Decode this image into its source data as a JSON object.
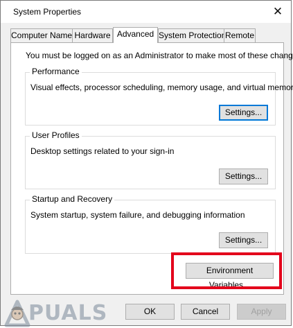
{
  "window": {
    "title": "System Properties",
    "close_glyph": "✕"
  },
  "tabs": [
    {
      "label": "Computer Name",
      "active": false
    },
    {
      "label": "Hardware",
      "active": false
    },
    {
      "label": "Advanced",
      "active": true
    },
    {
      "label": "System Protection",
      "active": false
    },
    {
      "label": "Remote",
      "active": false
    }
  ],
  "advanced": {
    "admin_message": "You must be logged on as an Administrator to make most of these changes.",
    "performance": {
      "title": "Performance",
      "description": "Visual effects, processor scheduling, memory usage, and virtual memory",
      "button": "Settings..."
    },
    "user_profiles": {
      "title": "User Profiles",
      "description": "Desktop settings related to your sign-in",
      "button": "Settings..."
    },
    "startup_recovery": {
      "title": "Startup and Recovery",
      "description": "System startup, system failure, and debugging information",
      "button": "Settings..."
    },
    "environment_button": "Environment Variables..."
  },
  "footer": {
    "ok": "OK",
    "cancel": "Cancel",
    "apply": "Apply"
  },
  "watermark": {
    "text": "PUALS"
  },
  "colors": {
    "highlight": "#e3001b",
    "focus": "#0078d7"
  }
}
